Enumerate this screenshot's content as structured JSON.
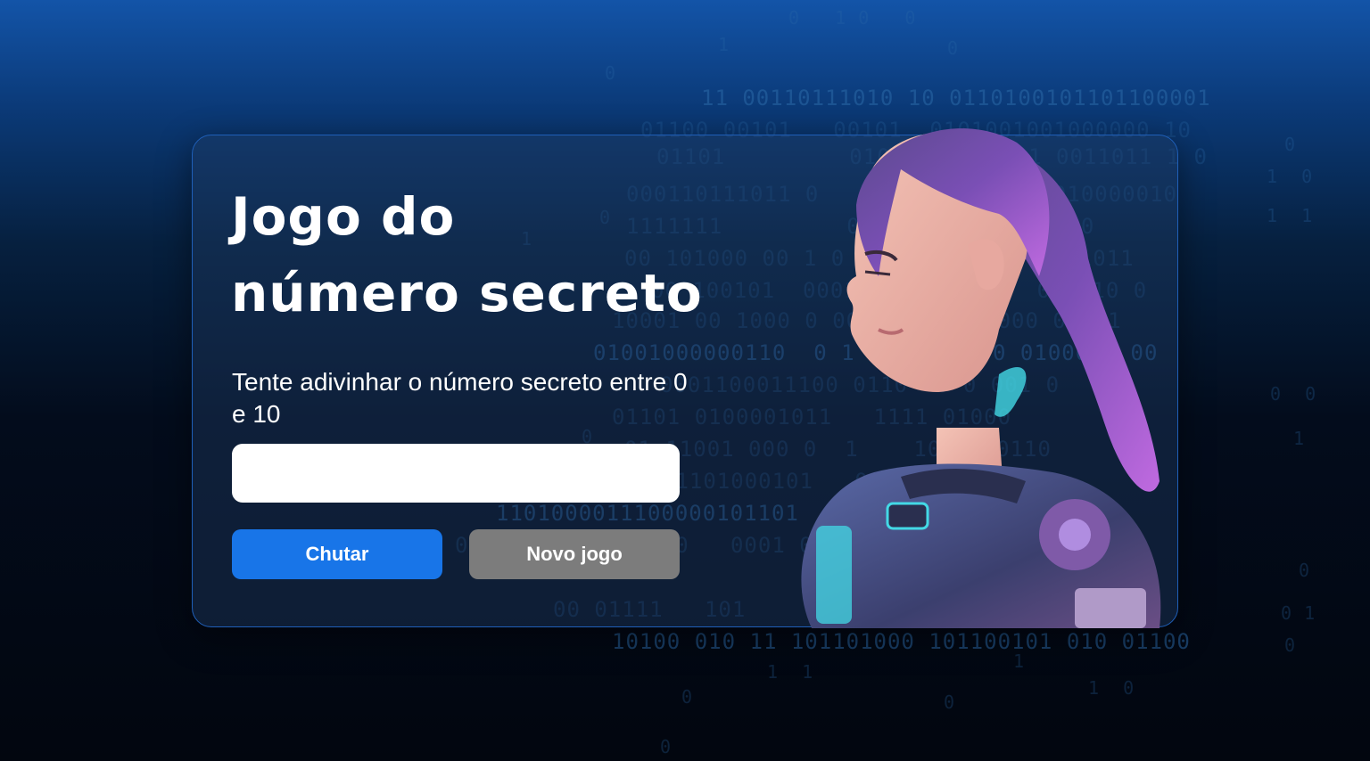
{
  "game": {
    "title_line1": "Jogo do",
    "title_line2": "número secreto",
    "instructions": "Tente adivinhar o número secreto entre 0 e 10",
    "input_value": "",
    "input_placeholder": "",
    "guess_button_label": "Chutar",
    "new_game_button_label": "Novo jogo"
  },
  "colors": {
    "primary_button": "#1875e8",
    "secondary_button": "#7c7c7c",
    "card_border": "#1f5fb8",
    "binary_text": "#2b6aa8"
  },
  "decor": {
    "background": "binary-code-pattern",
    "illustration": "woman-in-sci-fi-space-suit-with-purple-ponytail"
  }
}
